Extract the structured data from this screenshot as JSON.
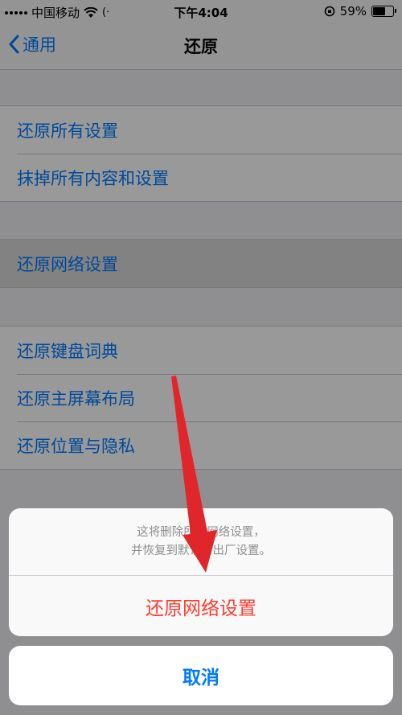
{
  "status_bar": {
    "carrier": "中国移动",
    "time": "下午4:04",
    "battery": "59%",
    "battery_level": 0.59
  },
  "nav": {
    "back_label": "通用",
    "title": "还原"
  },
  "groups": [
    {
      "items": [
        {
          "label": "还原所有设置"
        },
        {
          "label": "抹掉所有内容和设置"
        }
      ]
    },
    {
      "items": [
        {
          "label": "还原网络设置"
        }
      ]
    },
    {
      "items": [
        {
          "label": "还原键盘词典"
        },
        {
          "label": "还原主屏幕布局"
        },
        {
          "label": "还原位置与隐私"
        }
      ]
    }
  ],
  "action_sheet": {
    "message_line1": "这将删除所有网络设置，",
    "message_line2": "并恢复到默认的出厂设置。",
    "action_label": "还原网络设置",
    "cancel_label": "取消"
  },
  "colors": {
    "accent": "#007aff",
    "destructive": "#ff3b30",
    "annotation_arrow": "#e0262b"
  }
}
